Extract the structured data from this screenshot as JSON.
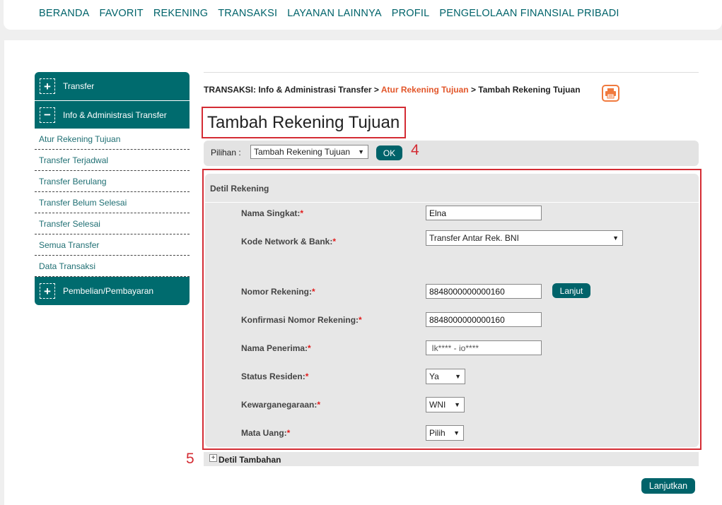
{
  "topnav": [
    "BERANDA",
    "FAVORIT",
    "REKENING",
    "TRANSAKSI",
    "LAYANAN LAINNYA",
    "PROFIL",
    "PENGELOLAAN FINANSIAL PRIBADI"
  ],
  "sidebar": {
    "transfer": {
      "icon": "+",
      "label": "Transfer"
    },
    "info_admin": {
      "icon": "−",
      "label": "Info & Administrasi Transfer"
    },
    "sub_items": [
      "Atur Rekening Tujuan",
      "Transfer Terjadwal",
      "Transfer Berulang",
      "Transfer Belum Selesai",
      "Transfer Selesai",
      "Semua Transfer",
      "Data Transaksi"
    ],
    "pembelian": {
      "icon": "+",
      "label": "Pembelian/Pembayaran"
    }
  },
  "breadcrumb": {
    "prefix": "TRANSAKSI: Info & Administrasi Transfer > ",
    "link": "Atur Rekening Tujuan",
    "current": " > Tambah Rekening Tujuan"
  },
  "page_title": "Tambah Rekening Tujuan",
  "pilihan": {
    "label": "Pilihan :",
    "selected": "Tambah Rekening Tujuan",
    "ok_label": "OK"
  },
  "annotations": {
    "four": "4",
    "five": "5"
  },
  "detil": {
    "title": "Detil Rekening",
    "nama_singkat": {
      "label": "Nama Singkat:",
      "value": "Elna"
    },
    "kode_network": {
      "label": "Kode Network & Bank:",
      "value": "Transfer Antar Rek. BNI"
    },
    "nomor_rekening": {
      "label": "Nomor Rekening:",
      "value": "8848000000000160",
      "button": "Lanjut"
    },
    "konfirmasi": {
      "label": "Konfirmasi Nomor Rekening:",
      "value": "8848000000000160"
    },
    "nama_penerima": {
      "label": "Nama Penerima:",
      "value": " Ik**** - io****"
    },
    "status_residen": {
      "label": "Status Residen:",
      "value": "Ya"
    },
    "kewarganegaraan": {
      "label": "Kewarganegaraan:",
      "value": "WNI"
    },
    "mata_uang": {
      "label": "Mata Uang:",
      "value": "Pilih"
    }
  },
  "required_mark": "*",
  "tambahan": {
    "icon": "+",
    "label": "Detil Tambahan"
  },
  "lanjutkan_label": "Lanjutkan",
  "colors": {
    "primary": "#00636a",
    "annotation": "#d42c34",
    "link": "#e2562a"
  }
}
